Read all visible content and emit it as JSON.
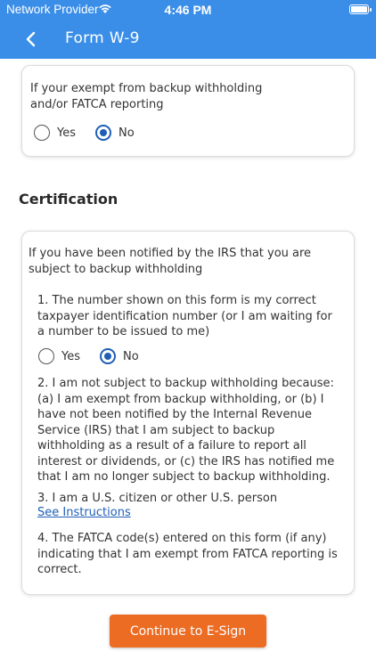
{
  "status_bar": {
    "carrier": "Network Provider",
    "time": "4:46 PM"
  },
  "nav": {
    "title": "Form W-9"
  },
  "exempt_card": {
    "question": "If your exempt from backup withholding and/or FATCA reporting",
    "options": [
      "Yes",
      "No"
    ],
    "selected": "No"
  },
  "certification": {
    "heading": "Certification",
    "intro": "If you have been notified by the IRS that you are subject to backup withholding",
    "item1": "1. The number shown on this form is my correct taxpayer identification number (or I am waiting for a number to be issued to me)",
    "item1_options": [
      "Yes",
      "No"
    ],
    "item1_selected": "No",
    "item2": "2. I am not subject to backup withholding because: (a) I am exempt from backup withholding, or (b) I have not been notified by the Internal Revenue Service (IRS) that I am subject to backup withholding as a result of a failure to report all interest or dividends, or (c) the IRS has notified me that I am no longer subject to backup withholding.",
    "item3": "3. I am a U.S. citizen or other U.S. person",
    "item3_link": "See Instructions",
    "item4": "4. The FATCA code(s) entered on this form (if any) indicating that I am exempt from FATCA reporting is correct."
  },
  "actions": {
    "continue_label": "Continue to E-Sign"
  },
  "colors": {
    "header": "#3a8ee8",
    "accent": "#1f5fb5",
    "cta": "#ed6c23"
  }
}
